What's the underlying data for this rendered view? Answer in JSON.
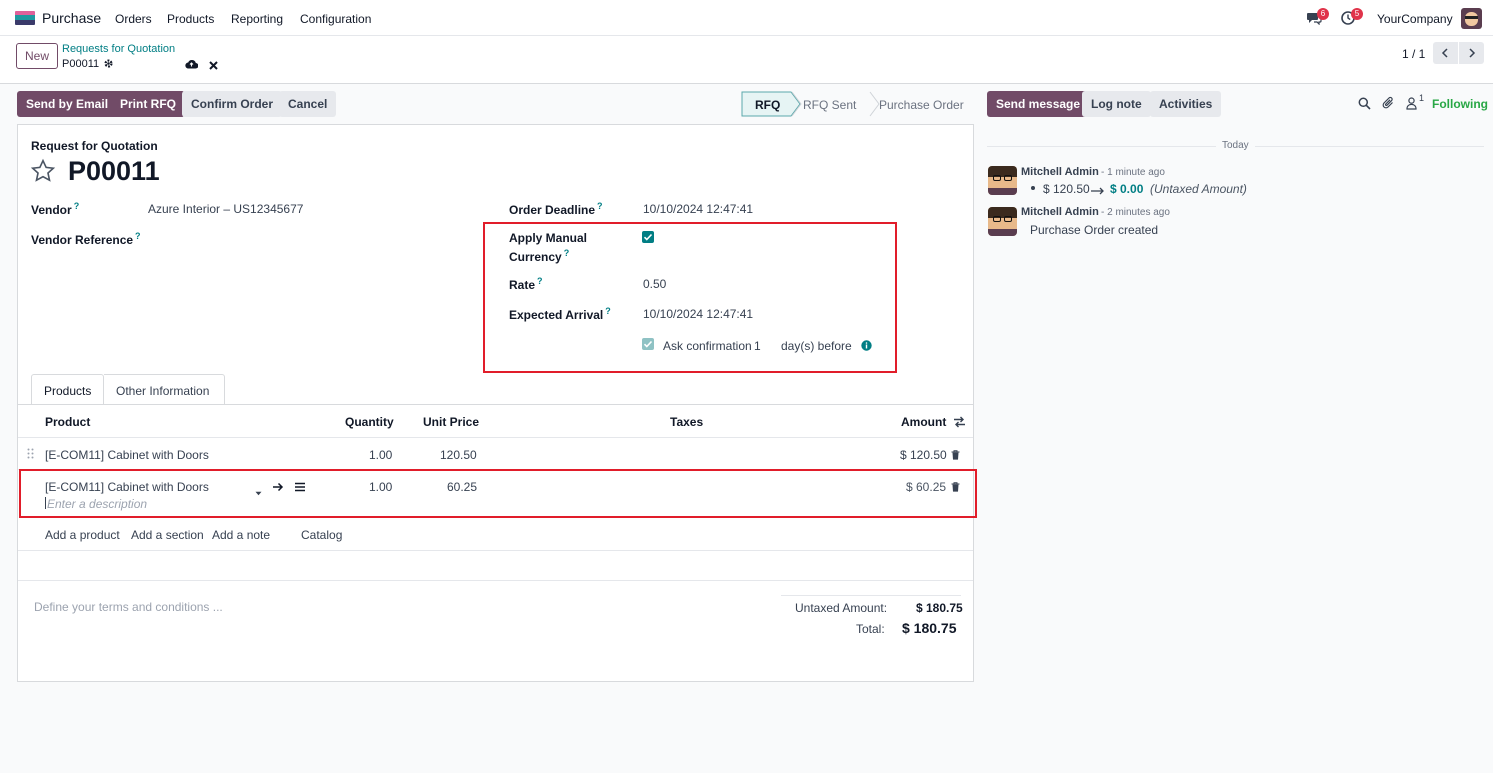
{
  "topbar": {
    "app_name": "Purchase",
    "menu": [
      "Orders",
      "Products",
      "Reporting",
      "Configuration"
    ],
    "messages_badge": "6",
    "activities_badge": "5",
    "company": "YourCompany"
  },
  "control": {
    "new_label": "New",
    "breadcrumb_parent": "Requests for Quotation",
    "breadcrumb_current": "P00011",
    "pager": "1 / 1"
  },
  "actions": {
    "send_by_email": "Send by Email",
    "print_rfq": "Print RFQ",
    "confirm_order": "Confirm Order",
    "cancel": "Cancel"
  },
  "statusbar": {
    "stages": [
      "RFQ",
      "RFQ Sent",
      "Purchase Order"
    ],
    "active": "RFQ"
  },
  "form": {
    "subtitle": "Request for Quotation",
    "reference": "P00011",
    "vendor_label": "Vendor",
    "vendor_value": "Azure Interior – US12345677",
    "vendor_ref_label": "Vendor Reference",
    "order_deadline_label": "Order Deadline",
    "order_deadline_value": "10/10/2024 12:47:41",
    "manual_currency_label_1": "Apply Manual",
    "manual_currency_label_2": "Currency",
    "manual_currency_checked": true,
    "rate_label": "Rate",
    "rate_value": "0.50",
    "expected_arrival_label": "Expected Arrival",
    "expected_arrival_value": "10/10/2024 12:47:41",
    "ask_confirmation_label": "Ask confirmation",
    "ask_confirmation_days": "1",
    "days_before": "day(s) before"
  },
  "tabs": [
    "Products",
    "Other Information"
  ],
  "table": {
    "headers": {
      "product": "Product",
      "quantity": "Quantity",
      "unit_price": "Unit Price",
      "taxes": "Taxes",
      "amount": "Amount"
    },
    "rows": [
      {
        "product": "[E-COM11] Cabinet with Doors",
        "quantity": "1.00",
        "unit_price": "120.50",
        "amount": "$ 120.50"
      },
      {
        "product": "[E-COM11] Cabinet with Doors",
        "quantity": "1.00",
        "unit_price": "60.25",
        "amount": "$ 60.25",
        "description_placeholder": "Enter a description"
      }
    ],
    "add_product": "Add a product",
    "add_section": "Add a section",
    "add_note": "Add a note",
    "catalog": "Catalog"
  },
  "footer": {
    "terms_placeholder": "Define your terms and conditions ...",
    "untaxed_label": "Untaxed Amount:",
    "untaxed_value": "$ 180.75",
    "total_label": "Total:",
    "total_value": "$ 180.75"
  },
  "chatter": {
    "send_message": "Send message",
    "log_note": "Log note",
    "activities": "Activities",
    "followers_count": "1",
    "following": "Following",
    "date_separator": "Today",
    "messages": [
      {
        "author": "Mitchell Admin",
        "time": "- 1 minute ago",
        "old_value": "$ 120.50",
        "new_value": "$ 0.00",
        "field": "(Untaxed Amount)"
      },
      {
        "author": "Mitchell Admin",
        "time": "- 2 minutes ago",
        "body": "Purchase Order created"
      }
    ]
  },
  "colors": {
    "brand": "#714b67",
    "accent": "#017e84",
    "highlight_box": "#e11d2a",
    "following": "#28a745"
  }
}
